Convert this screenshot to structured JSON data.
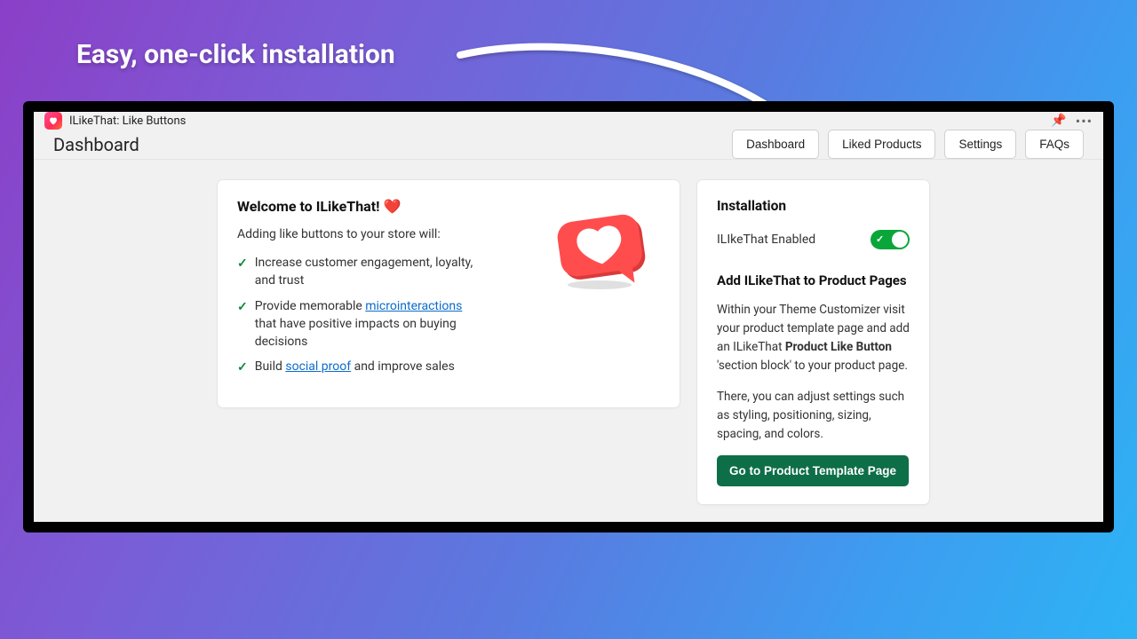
{
  "annotation": "Easy, one-click installation",
  "titlebar": {
    "app_name": "ILikeThat: Like Buttons"
  },
  "nav": {
    "title": "Dashboard",
    "buttons": [
      "Dashboard",
      "Liked Products",
      "Settings",
      "FAQs"
    ]
  },
  "welcome": {
    "title_prefix": "Welcome to ILikeThat! ",
    "subtitle": "Adding like buttons to your store will:",
    "benefits": {
      "b0": "Increase customer engagement, loyalty, and trust",
      "b1_pre": "Provide memorable ",
      "b1_link": "microinteractions",
      "b1_post": " that have positive impacts on buying decisions",
      "b2_pre": "Build ",
      "b2_link": "social proof",
      "b2_post": " and improve sales"
    }
  },
  "install": {
    "title": "Installation",
    "toggle_label": "ILIkeThat Enabled",
    "toggle_on": true,
    "add_title": "Add ILikeThat to Product Pages",
    "p1_pre": "Within your Theme Customizer visit your product template page and add an ILikeThat ",
    "p1_bold": "Product Like Button",
    "p1_post": " 'section block' to your product page.",
    "p2": "There, you can adjust settings such as styling, positioning, sizing, spacing, and colors.",
    "cta": "Go to Product Template Page"
  },
  "colors": {
    "accent_green": "#0d6e47",
    "toggle_green": "#0aa63a",
    "check_green": "#0a8a3a",
    "link_blue": "#0b6bcb"
  }
}
